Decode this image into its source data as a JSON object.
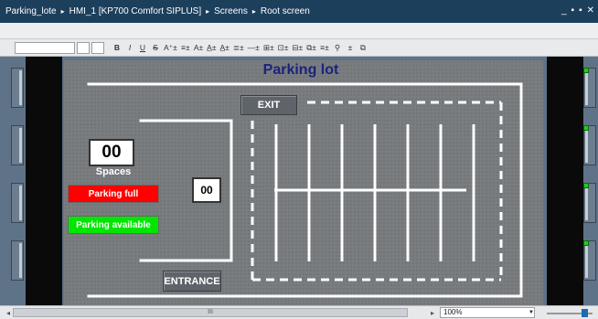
{
  "breadcrumb": {
    "items": [
      "Parking_lote",
      "HMI_1 [KP700 Comfort SIPLUS]",
      "Screens",
      "Root screen"
    ],
    "separator": "▸"
  },
  "window_controls": {
    "minimize": "_",
    "restore": "▪",
    "float": "▪",
    "close": "✕"
  },
  "toolbar": {
    "buttons": [
      "B",
      "I",
      "U",
      "S",
      "A⁺±",
      "≡±",
      "A±",
      "A̲±",
      "A̲±",
      "≣±",
      "—±",
      "⊞±",
      "⊡±",
      "⊟±",
      "⧉±",
      "≡±",
      "⚲",
      "±",
      "⧉"
    ]
  },
  "screen": {
    "title": "Parking lot",
    "exit_label": "EXIT",
    "entrance_label": "ENTRANCE",
    "spaces_value": "00",
    "spaces_label": "Spaces",
    "counter_value": "00",
    "parking_full_label": "Parking full",
    "parking_available_label": "Parking available"
  },
  "scrollbar": {
    "left_arrow": "◂",
    "right_arrow": "▸",
    "thumb_grip": "III"
  },
  "zoom": {
    "value": "100%"
  },
  "colors": {
    "title_text": "#1a237e",
    "full": "#ff0000",
    "available": "#00e600",
    "screen_bg": "#7a7d80",
    "titlebar": "#1c3f5c"
  }
}
